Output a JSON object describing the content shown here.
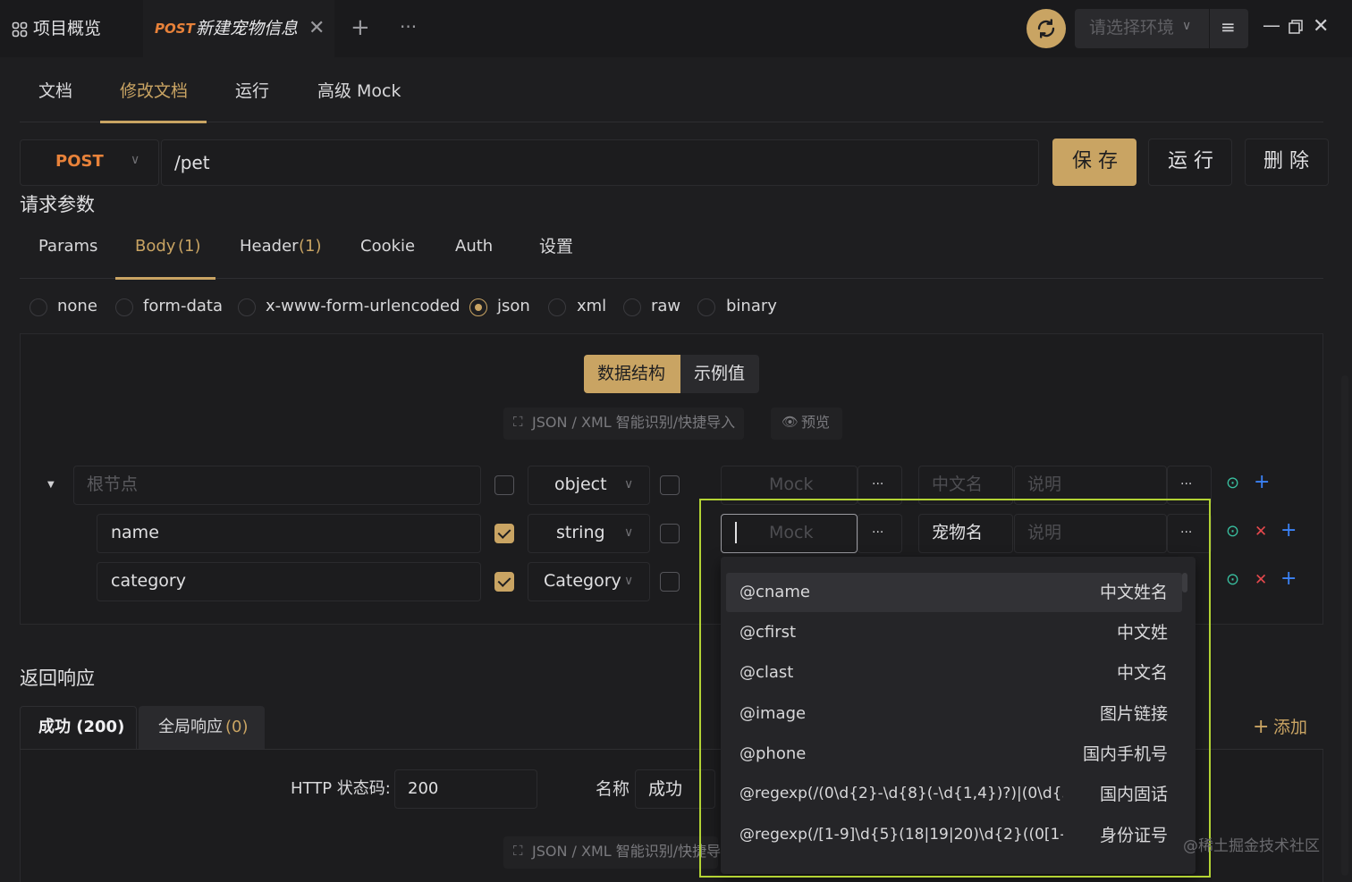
{
  "titlebar": {
    "overview_label": "项目概览",
    "tab_method": "POST",
    "tab_title": "新建宠物信息",
    "env_placeholder": "请选择环境"
  },
  "doc_tabs": [
    "文档",
    "修改文档",
    "运行",
    "高级 Mock"
  ],
  "request": {
    "method": "POST",
    "path": "/pet",
    "save_label": "保 存",
    "run_label": "运 行",
    "delete_label": "删 除"
  },
  "params_section": {
    "title": "请求参数",
    "tabs": [
      "Params",
      "Body",
      "Header",
      "Cookie",
      "Auth",
      "设置"
    ],
    "body_count": "(1)",
    "header_count": "(1)"
  },
  "body_types": [
    "none",
    "form-data",
    "x-www-form-urlencoded",
    "json",
    "xml",
    "raw",
    "binary"
  ],
  "body_type_selected": "json",
  "editor": {
    "toggle_structure": "数据结构",
    "toggle_example": "示例值",
    "import_label": "JSON / XML 智能识别/快捷导入",
    "preview_label": "预览"
  },
  "schema_rows": [
    {
      "name_placeholder": "根节点",
      "type": "object",
      "mock_placeholder": "Mock",
      "cn_placeholder": "中文名",
      "desc_placeholder": "说明"
    },
    {
      "name": "name",
      "type": "string",
      "mock_placeholder": "Mock",
      "cn_value": "宠物名",
      "desc_placeholder": "说明"
    },
    {
      "name": "category",
      "type": "Category"
    }
  ],
  "mock_dropdown": [
    {
      "code": "@cname",
      "label": "中文姓名"
    },
    {
      "code": "@cfirst",
      "label": "中文姓"
    },
    {
      "code": "@clast",
      "label": "中文名"
    },
    {
      "code": "@image",
      "label": "图片链接"
    },
    {
      "code": "@phone",
      "label": "国内手机号"
    },
    {
      "code": "@regexp(/(0\\d{2}-\\d{8}(-\\d{1,4})?)|(0\\d{3}-...",
      "label": "国内固话"
    },
    {
      "code": "@regexp(/[1-9]\\d{5}(18|19|20)\\d{2}((0[1-9]...",
      "label": "身份证号"
    }
  ],
  "response": {
    "title": "返回响应",
    "tab_success": "成功 (200)",
    "tab_global": "全局响应",
    "tab_global_count": "(0)",
    "add_label": "添加",
    "status_code_label": "HTTP 状态码:",
    "status_code_value": "200",
    "name_label": "名称",
    "name_value": "成功",
    "import_label": "JSON / XML 智能识别/快捷导"
  },
  "watermark": "@稀土掘金技术社区",
  "colors": {
    "accent": "#c9a463",
    "method": "#e8823a",
    "highlight": "#b3d334",
    "icon_green": "#39c0a0",
    "icon_blue": "#3b82f6",
    "icon_red": "#e5484d"
  }
}
